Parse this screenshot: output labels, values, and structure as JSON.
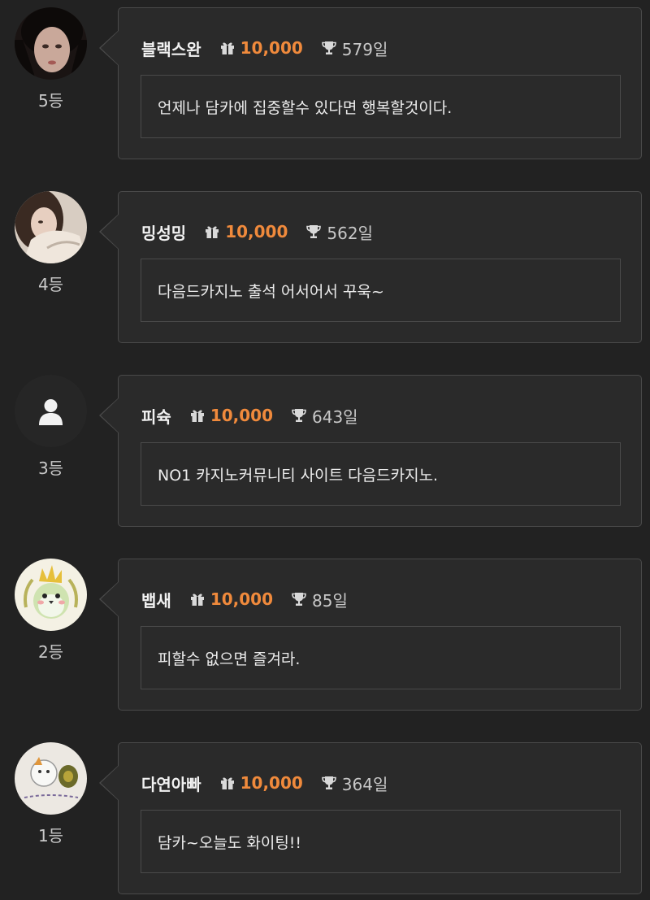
{
  "colors": {
    "background": "#222222",
    "card_border": "#4a4a4a",
    "points": "#f08a3c"
  },
  "icons": {
    "gift": "gift-icon",
    "trophy": "trophy-icon",
    "default_user": "user-silhouette-icon"
  },
  "entries": [
    {
      "nickname": "블랙스완",
      "points": "10,000",
      "days": "579일",
      "rank": "5등",
      "message": "언제나 담카에 집중할수 있다면 행복할것이다.",
      "avatar": "photo"
    },
    {
      "nickname": "밍성밍",
      "points": "10,000",
      "days": "562일",
      "rank": "4등",
      "message": "다음드카지노 출석 어서어서 꾸욱~",
      "avatar": "photo"
    },
    {
      "nickname": "피슉",
      "points": "10,000",
      "days": "643일",
      "rank": "3등",
      "message": "NO1 카지노커뮤니티 사이트 다음드카지노.",
      "avatar": "default"
    },
    {
      "nickname": "뱁새",
      "points": "10,000",
      "days": "85일",
      "rank": "2등",
      "message": "피할수 없으면 즐겨라.",
      "avatar": "bird-illustration"
    },
    {
      "nickname": "다연아빠",
      "points": "10,000",
      "days": "364일",
      "rank": "1등",
      "message": "담카~오늘도 화이팅!!",
      "avatar": "drawing"
    }
  ]
}
